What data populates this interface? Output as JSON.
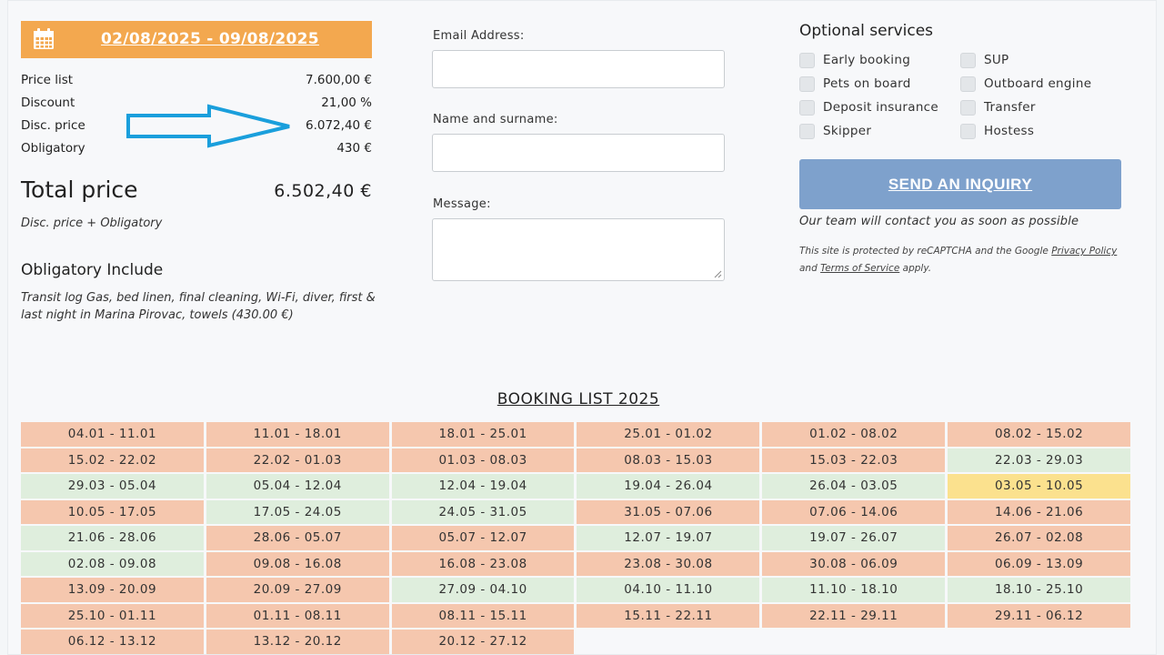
{
  "summary": {
    "date_range": "02/08/2025 - 09/08/2025",
    "rows": [
      {
        "label": "Price list",
        "value": "7.600,00 €"
      },
      {
        "label": "Discount",
        "value": "21,00 %"
      },
      {
        "label": "Disc. price",
        "value": "6.072,40 €"
      },
      {
        "label": "Obligatory",
        "value": "430 €"
      }
    ],
    "total_label": "Total price",
    "total_value": "6.502,40 €",
    "total_note": "Disc. price + Obligatory",
    "obligatory_title": "Obligatory Include",
    "obligatory_text": "Transit log Gas, bed linen, final cleaning, Wi-Fi, diver, first & last night in Marina Pirovac, towels (430.00 €)"
  },
  "form": {
    "email_label": "Email Address:",
    "email_value": "",
    "name_label": "Name and surname:",
    "name_value": "",
    "message_label": "Message:",
    "message_value": ""
  },
  "services": {
    "title": "Optional services",
    "options": [
      {
        "label": "Early booking",
        "checked": false
      },
      {
        "label": "SUP",
        "checked": false
      },
      {
        "label": "Pets on board",
        "checked": false
      },
      {
        "label": "Outboard engine",
        "checked": false
      },
      {
        "label": "Deposit insurance",
        "checked": false
      },
      {
        "label": "Transfer",
        "checked": false
      },
      {
        "label": "Skipper",
        "checked": false
      },
      {
        "label": "Hostess",
        "checked": false
      }
    ],
    "send_label": "SEND AN INQUIRY",
    "contact_note": "Our team will contact you as soon as possible",
    "captcha_pre": "This site is protected by reCAPTCHA and the Google ",
    "privacy_link": "Privacy Policy",
    "captcha_and": " and ",
    "terms_link": "Terms of Service",
    "captcha_post": " apply."
  },
  "booking": {
    "title": "BOOKING LIST 2025",
    "colors": {
      "booked": "#f5c7ae",
      "free": "#dfeedd",
      "option": "#fbe18e"
    },
    "weeks": [
      {
        "label": "04.01 - 11.01",
        "status": "booked"
      },
      {
        "label": "11.01 - 18.01",
        "status": "booked"
      },
      {
        "label": "18.01 - 25.01",
        "status": "booked"
      },
      {
        "label": "25.01 - 01.02",
        "status": "booked"
      },
      {
        "label": "01.02 - 08.02",
        "status": "booked"
      },
      {
        "label": "08.02 - 15.02",
        "status": "booked"
      },
      {
        "label": "15.02 - 22.02",
        "status": "booked"
      },
      {
        "label": "22.02 - 01.03",
        "status": "booked"
      },
      {
        "label": "01.03 - 08.03",
        "status": "booked"
      },
      {
        "label": "08.03 - 15.03",
        "status": "booked"
      },
      {
        "label": "15.03 - 22.03",
        "status": "booked"
      },
      {
        "label": "22.03 - 29.03",
        "status": "free"
      },
      {
        "label": "29.03 - 05.04",
        "status": "free"
      },
      {
        "label": "05.04 - 12.04",
        "status": "free"
      },
      {
        "label": "12.04 - 19.04",
        "status": "free"
      },
      {
        "label": "19.04 - 26.04",
        "status": "free"
      },
      {
        "label": "26.04 - 03.05",
        "status": "free"
      },
      {
        "label": "03.05 - 10.05",
        "status": "option"
      },
      {
        "label": "10.05 - 17.05",
        "status": "booked"
      },
      {
        "label": "17.05 - 24.05",
        "status": "free"
      },
      {
        "label": "24.05 - 31.05",
        "status": "free"
      },
      {
        "label": "31.05 - 07.06",
        "status": "booked"
      },
      {
        "label": "07.06 - 14.06",
        "status": "booked"
      },
      {
        "label": "14.06 - 21.06",
        "status": "booked"
      },
      {
        "label": "21.06 - 28.06",
        "status": "free"
      },
      {
        "label": "28.06 - 05.07",
        "status": "booked"
      },
      {
        "label": "05.07 - 12.07",
        "status": "booked"
      },
      {
        "label": "12.07 - 19.07",
        "status": "free"
      },
      {
        "label": "19.07 - 26.07",
        "status": "free"
      },
      {
        "label": "26.07 - 02.08",
        "status": "booked"
      },
      {
        "label": "02.08 - 09.08",
        "status": "free"
      },
      {
        "label": "09.08 - 16.08",
        "status": "booked"
      },
      {
        "label": "16.08 - 23.08",
        "status": "booked"
      },
      {
        "label": "23.08 - 30.08",
        "status": "booked"
      },
      {
        "label": "30.08 - 06.09",
        "status": "booked"
      },
      {
        "label": "06.09 - 13.09",
        "status": "booked"
      },
      {
        "label": "13.09 - 20.09",
        "status": "booked"
      },
      {
        "label": "20.09 - 27.09",
        "status": "booked"
      },
      {
        "label": "27.09 - 04.10",
        "status": "free"
      },
      {
        "label": "04.10 - 11.10",
        "status": "free"
      },
      {
        "label": "11.10 - 18.10",
        "status": "free"
      },
      {
        "label": "18.10 - 25.10",
        "status": "free"
      },
      {
        "label": "25.10 - 01.11",
        "status": "booked"
      },
      {
        "label": "01.11 - 08.11",
        "status": "booked"
      },
      {
        "label": "08.11 - 15.11",
        "status": "booked"
      },
      {
        "label": "15.11 - 22.11",
        "status": "booked"
      },
      {
        "label": "22.11 - 29.11",
        "status": "booked"
      },
      {
        "label": "29.11 - 06.12",
        "status": "booked"
      },
      {
        "label": "06.12 - 13.12",
        "status": "booked"
      },
      {
        "label": "13.12 - 20.12",
        "status": "booked"
      },
      {
        "label": "20.12 - 27.12",
        "status": "booked"
      }
    ]
  },
  "icons": {
    "calendar": "calendar-icon",
    "arrow": "arrow-right-icon"
  },
  "accent": {
    "date_bar": "#f3a84f",
    "send_button": "#7ea1cc",
    "arrow": "#1a9fdc"
  }
}
